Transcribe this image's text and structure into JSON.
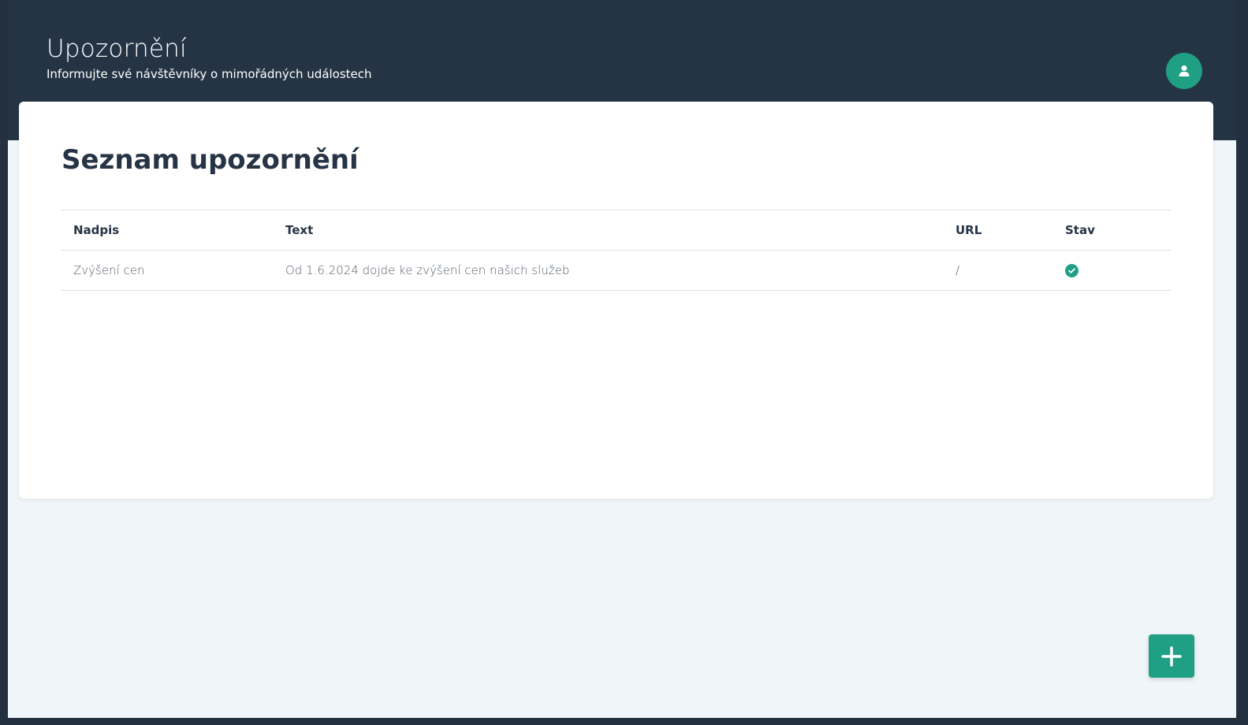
{
  "header": {
    "title": "Upozornění",
    "subtitle": "Informujte své návštěvníky o mimořádných událostech",
    "avatar_icon": "user-icon"
  },
  "card": {
    "title": "Seznam upozornění"
  },
  "table": {
    "columns": [
      "Nadpis",
      "Text",
      "URL",
      "Stav"
    ],
    "rows": [
      {
        "title": "Zvýšení cen",
        "text": "Od 1.6.2024 dojde ke zvýšení cen našich služeb",
        "url": "/",
        "status_icon": "check-circle-icon",
        "status": "active"
      }
    ]
  },
  "fab": {
    "icon": "plus-icon"
  },
  "colors": {
    "header_bg": "#243444",
    "accent": "#1fa085",
    "page_bg": "#f0f5f9",
    "text_dark": "#263445"
  }
}
